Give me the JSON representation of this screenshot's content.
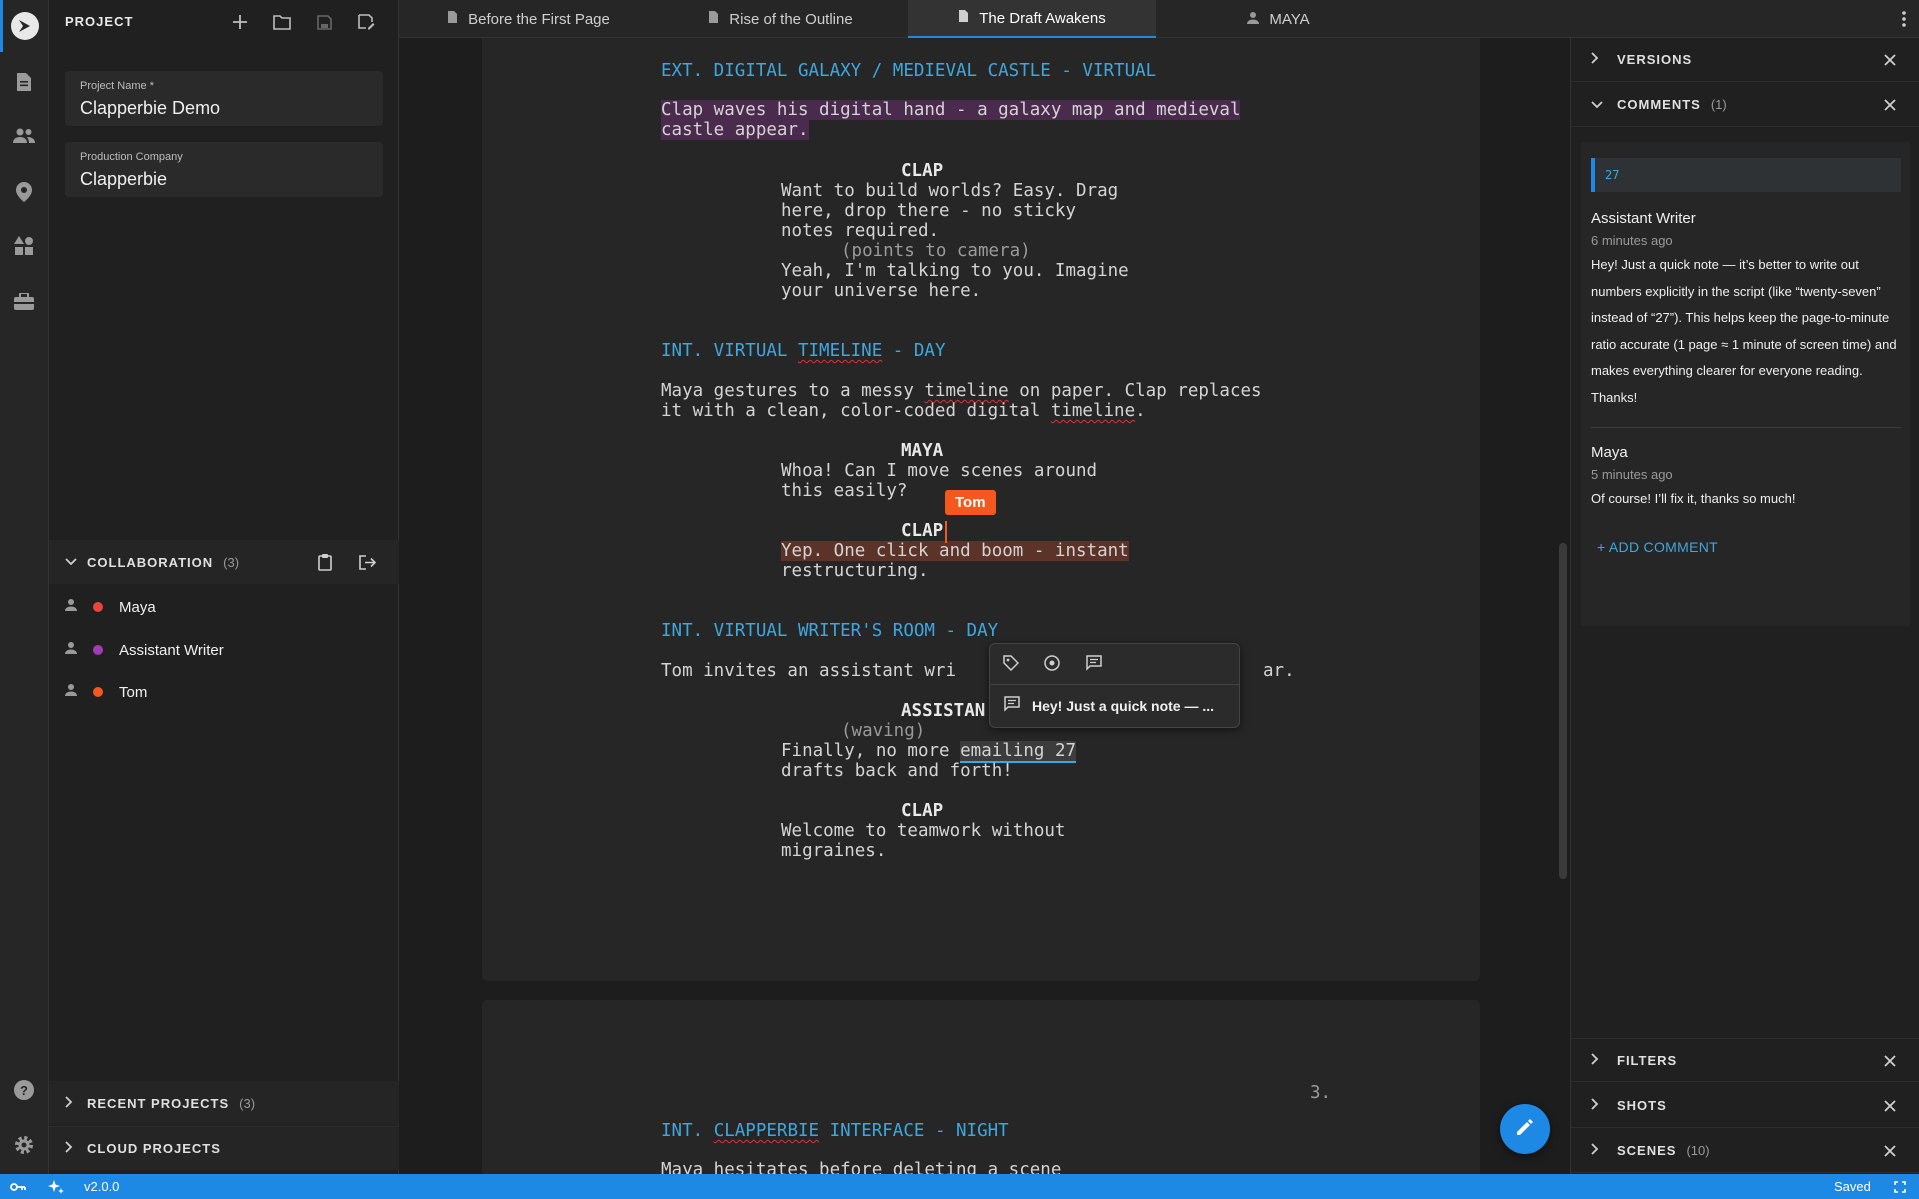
{
  "project_panel": {
    "title": "PROJECT",
    "project_name_label": "Project Name *",
    "project_name_value": "Clapperbie Demo",
    "company_label": "Production Company",
    "company_value": "Clapperbie"
  },
  "collaboration": {
    "title": "COLLABORATION",
    "count": "(3)",
    "users": [
      {
        "name": "Maya",
        "color": "#e9453c"
      },
      {
        "name": "Assistant Writer",
        "color": "#a13bb6"
      },
      {
        "name": "Tom",
        "color": "#f4581f"
      }
    ]
  },
  "recent_projects": {
    "title": "RECENT PROJECTS",
    "count": "(3)"
  },
  "cloud_projects": {
    "title": "CLOUD PROJECTS"
  },
  "tabs": [
    {
      "label": "Before the First Page",
      "icon": "document-icon"
    },
    {
      "label": "Rise of the Outline",
      "icon": "document-icon"
    },
    {
      "label": "The Draft Awakens",
      "icon": "document-icon",
      "active": true
    },
    {
      "label": "MAYA",
      "icon": "person-icon"
    }
  ],
  "script": {
    "s1_heading": "EXT. DIGITAL GALAXY / MEDIEVAL CASTLE - VIRTUAL",
    "s1_action_1": "Clap waves his digital hand - a galaxy map and medieval",
    "s1_action_2": "castle appear.",
    "s1_char": "CLAP",
    "s1_d1": "Want to build worlds? Easy. Drag",
    "s1_d2": "here, drop there - no sticky",
    "s1_d3": "notes required.",
    "s1_paren": "(points to camera)",
    "s1_d4": "Yeah, I'm talking to you. Imagine",
    "s1_d5": "your universe here.",
    "s2_heading_a": "INT. VIRTUAL ",
    "s2_heading_b": "TIMELINE",
    "s2_heading_c": " - DAY",
    "s2_a1a": "Maya gestures to a messy ",
    "s2_a1b": "timeline",
    "s2_a1c": " on paper. Clap replaces",
    "s2_a2a": "it with a clean, color-coded digital ",
    "s2_a2b": "timeline",
    "s2_a2c": ".",
    "s2_char1": "MAYA",
    "s2_d1": "Whoa! Can I move scenes around",
    "s2_d2": "this easily?",
    "s2_char2": "CLAP",
    "s2_d3": "Yep. One click and boom - instant",
    "s2_d4": "restructuring.",
    "s3_heading": "INT. VIRTUAL WRITER'S ROOM - DAY",
    "s3_action": "Tom invites an assistant wri",
    "s3_action_tail": "ar.",
    "s3_char": "ASSISTAN",
    "s3_paren": "(waving)",
    "s3_d1a": "Finally, no more ",
    "s3_d1b": "emailing 27",
    "s3_d2": "drafts back and forth!",
    "s3_char2": "CLAP",
    "s3_d3": "Welcome to teamwork without",
    "s3_d4": "migraines.",
    "page_number": "3.",
    "s4_heading_a": "INT. ",
    "s4_heading_b": "CLAPPERBIE",
    "s4_heading_c": " INTERFACE - NIGHT",
    "s4_action": "Maya hesitates before deleting a scene"
  },
  "cursor": {
    "label": "Tom",
    "color": "#f4581f"
  },
  "popup": {
    "preview": "Hey! Just a quick note — ..."
  },
  "right_panel": {
    "versions": "VERSIONS",
    "comments": "COMMENTS",
    "comments_count": "(1)",
    "quote": "27",
    "c1_author": "Assistant Writer",
    "c1_time": "6 minutes ago",
    "c1_text": "Hey! Just a quick note — it’s better to write out numbers explicitly in the script (like “twenty-seven” instead of “27”). This helps keep the page-to-minute ratio accurate (1 page ≈ 1 minute of screen time) and makes everything clearer for everyone reading. Thanks!",
    "c2_author": "Maya",
    "c2_time": "5 minutes ago",
    "c2_text": "Of course! I’ll fix it, thanks so much!",
    "add_comment": "+ ADD COMMENT",
    "filters": "FILTERS",
    "shots": "SHOTS",
    "scenes": "SCENES",
    "scenes_count": "(10)"
  },
  "status": {
    "version": "v2.0.0",
    "saved": "Saved"
  },
  "colors": {
    "accent": "#1e88e5",
    "heading": "#3fa7e0"
  }
}
